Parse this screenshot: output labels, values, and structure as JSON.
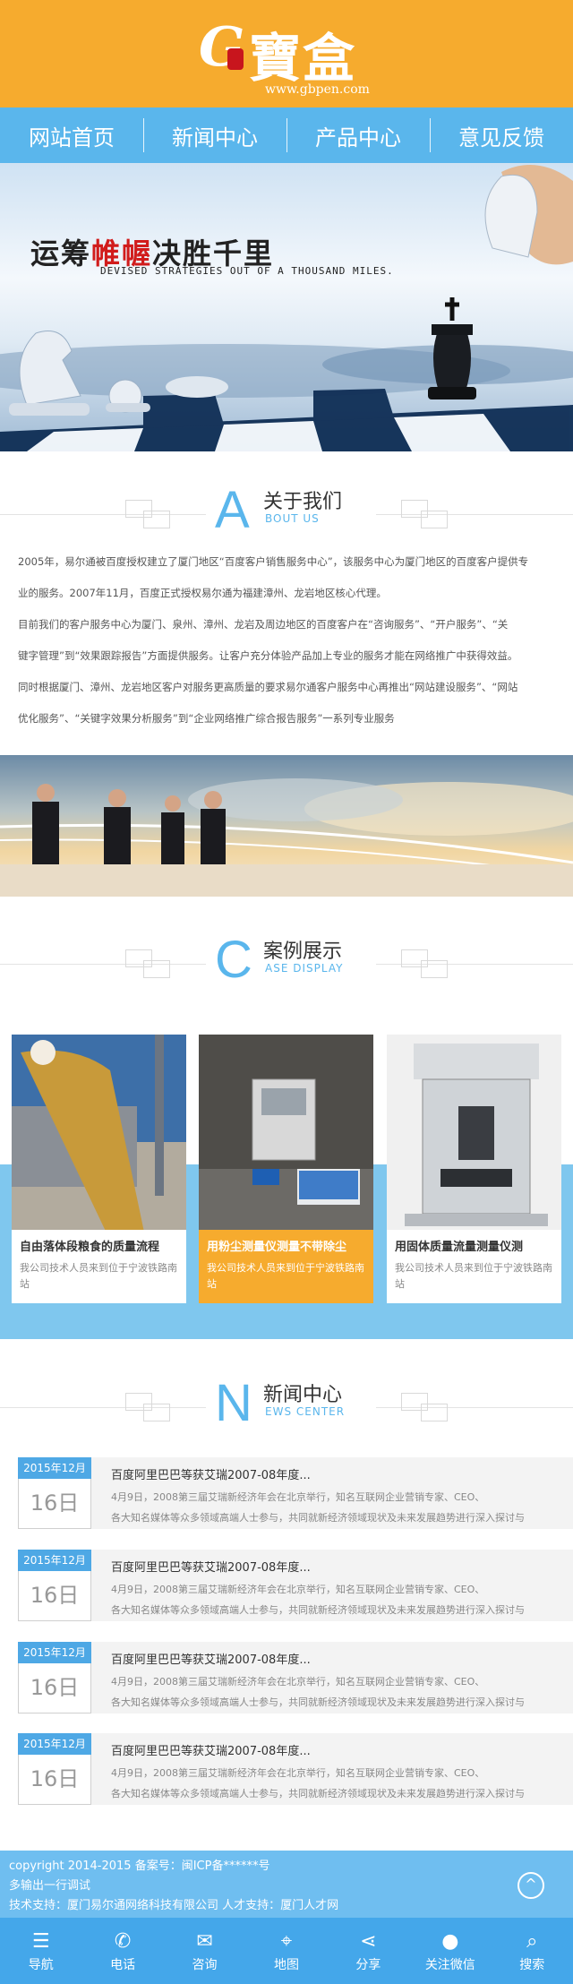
{
  "header": {
    "logo_url": "www.gbpen.com",
    "logo_cn": "寶盒",
    "logo_g": "G"
  },
  "nav": [
    "网站首页",
    "新闻中心",
    "产品中心",
    "意见反馈"
  ],
  "banner": {
    "title_a": "运筹",
    "title_b": "帷幄",
    "title_c": "决胜千里",
    "subtitle": "DEVISED STRATEGIES OUT OF A THOUSAND MILES."
  },
  "about": {
    "letter": "A",
    "title": "关于我们",
    "en": "BOUT US",
    "lines": [
      "2005年，易尔通被百度授权建立了厦门地区“百度客户销售服务中心”，该服务中心为厦门地区的百度客户提供专",
      "业的服务。2007年11月，百度正式授权易尔通为福建漳州、龙岩地区核心代理。",
      "目前我们的客户服务中心为厦门、泉州、漳州、龙岩及周边地区的百度客户在“咨询服务”、“开户服务”、“关",
      "键字管理”到“效果跟踪报告”方面提供服务。让客户充分体验产品加上专业的服务才能在网络推广中获得效益。",
      "同时根据厦门、漳州、龙岩地区客户对服务更高质量的要求易尔通客户服务中心再推出“网站建设服务”、“网站",
      "优化服务”、“关键字效果分析服务”到“企业网络推广综合报告服务”一系列专业服务"
    ]
  },
  "cases": {
    "letter": "C",
    "title": "案例展示",
    "en": "ASE DISPLAY",
    "items": [
      {
        "title": "自由落体段粮食的质量流程",
        "desc": "我公司技术人员来到位于宁波铁路南站"
      },
      {
        "title": "用粉尘测量仪测量不带除尘",
        "desc": "我公司技术人员来到位于宁波铁路南站"
      },
      {
        "title": "用固体质量流量测量仪测",
        "desc": "我公司技术人员来到位于宁波铁路南站"
      }
    ]
  },
  "news": {
    "letter": "N",
    "title": "新闻中心",
    "en": "EWS CENTER",
    "items": [
      {
        "ym": "2015年12月",
        "day": "16日",
        "title": "百度阿里巴巴等获艾瑞2007-08年度...",
        "s1": "4月9日，2008第三届艾瑞新经济年会在北京举行，知名互联网企业营销专家、CEO、",
        "s2": "各大知名媒体等众多领域高端人士参与，共同就新经济领域现状及未来发展趋势进行深入探讨与"
      },
      {
        "ym": "2015年12月",
        "day": "16日",
        "title": "百度阿里巴巴等获艾瑞2007-08年度...",
        "s1": "4月9日，2008第三届艾瑞新经济年会在北京举行，知名互联网企业营销专家、CEO、",
        "s2": "各大知名媒体等众多领域高端人士参与，共同就新经济领域现状及未来发展趋势进行深入探讨与"
      },
      {
        "ym": "2015年12月",
        "day": "16日",
        "title": "百度阿里巴巴等获艾瑞2007-08年度...",
        "s1": "4月9日，2008第三届艾瑞新经济年会在北京举行，知名互联网企业营销专家、CEO、",
        "s2": "各大知名媒体等众多领域高端人士参与，共同就新经济领域现状及未来发展趋势进行深入探讨与"
      },
      {
        "ym": "2015年12月",
        "day": "16日",
        "title": "百度阿里巴巴等获艾瑞2007-08年度...",
        "s1": "4月9日，2008第三届艾瑞新经济年会在北京举行，知名互联网企业营销专家、CEO、",
        "s2": "各大知名媒体等众多领域高端人士参与，共同就新经济领域现状及未来发展趋势进行深入探讨与"
      }
    ]
  },
  "footer": {
    "line1": "copyright 2014-2015 备案号：闽ICP备******号",
    "line2": "多输出一行调试",
    "line3": "技术支持：厦门易尔通网络科技有限公司 人才支持：厦门人才网",
    "top_icon": "arrow-up-icon"
  },
  "tabbar": [
    {
      "label": "导航",
      "icon": "menu-icon"
    },
    {
      "label": "电话",
      "icon": "phone-icon"
    },
    {
      "label": "咨询",
      "icon": "chat-icon"
    },
    {
      "label": "地图",
      "icon": "map-icon"
    },
    {
      "label": "分享",
      "icon": "share-icon"
    },
    {
      "label": "关注微信",
      "icon": "wechat-icon"
    },
    {
      "label": "搜索",
      "icon": "search-icon"
    }
  ]
}
